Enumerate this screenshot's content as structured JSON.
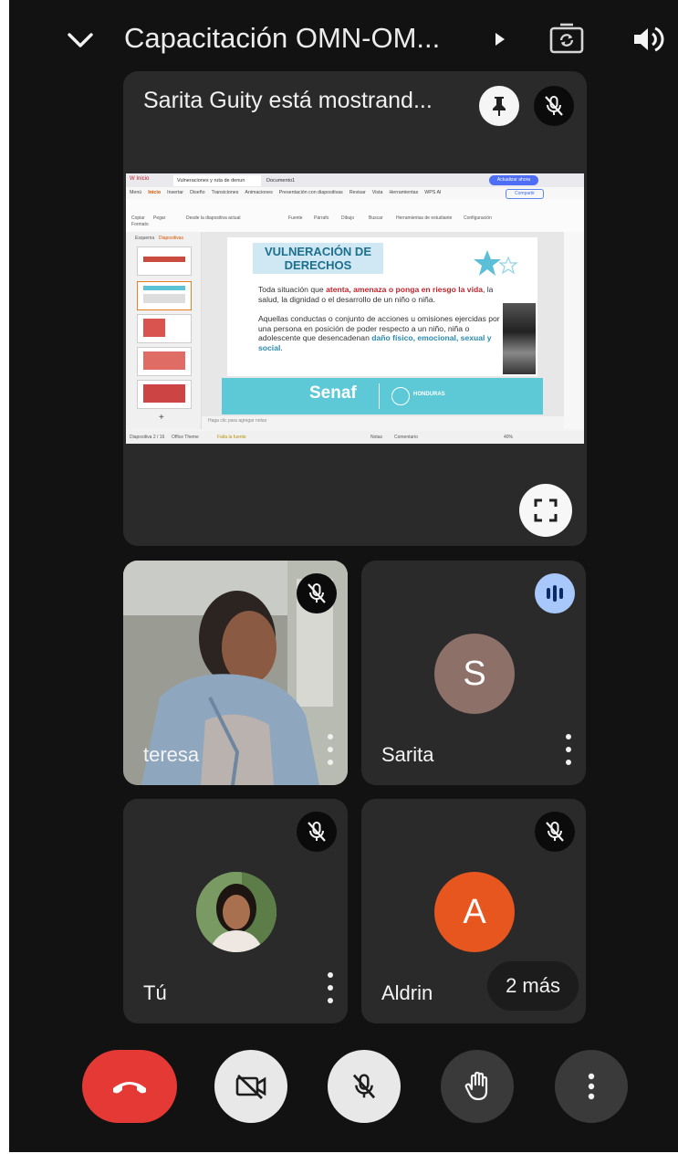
{
  "topbar": {
    "title": "Capacitación OMN-OM...",
    "icons": [
      "chevron-down-icon",
      "play-arrow-icon",
      "switch-camera-icon",
      "speaker-icon"
    ]
  },
  "presentation": {
    "presenter_label": "Sarita Guity está mostrand...",
    "icons": [
      "pin-icon",
      "mic-off-icon",
      "fullscreen-icon"
    ],
    "shared_screen": {
      "tabs": [
        "Vulneraciones y ruta de denun",
        "Documento1"
      ],
      "update_button": "Actualizar ahora",
      "menu": [
        "Menú",
        "Inicio",
        "Insertar",
        "Diseño",
        "Transiciones",
        "Animaciones",
        "Presentación con diapositivas",
        "Revisar",
        "Vista",
        "Herramientas",
        "WPS AI"
      ],
      "share_button": "Compartir",
      "ribbon": [
        "Copiar",
        "Formato",
        "Pegar",
        "Desde la diapositiva actual",
        "Fuente",
        "Párrafo",
        "Dibujo",
        "Buscar",
        "Herramientas de estudiante",
        "Configuración"
      ],
      "panel_tabs": [
        "Esquema",
        "Diapositivas"
      ],
      "slide": {
        "title_line1": "VULNERACIÓN DE",
        "title_line2": "DERECHOS",
        "p1_a": "Toda situación que ",
        "p1_red1": "atenta, amenaza o ponga en riesgo la vida",
        "p1_b": ", la salud, la dignidad o el desarrollo de un niño o niña.",
        "p2_a": "Aquellas conductas o conjunto de acciones u omisiones ejercidas por una persona en posición de poder respecto a un niño, niña o adolescente que desencadenan ",
        "p2_blue": "daño físico, emocional, sexual y social",
        "p2_b": ".",
        "logo_text": "Senaf",
        "country_text": "HONDURAS"
      },
      "notes_placeholder": "Haga clic para agregar notas",
      "status": {
        "slide_count": "Diapositiva 2 / 16",
        "theme": "Office Theme",
        "font_warning": "Falta la fuente",
        "notes": "Notas",
        "comments": "Comentario",
        "zoom": "40%"
      }
    }
  },
  "participants": [
    {
      "name": "teresa",
      "status_icon": "mic-off-icon",
      "kind": "video"
    },
    {
      "name": "Sarita",
      "status_icon": "speaking-icon",
      "initial": "S",
      "avatar_color": "#8d7068",
      "kind": "letter"
    },
    {
      "name": "Tú",
      "status_icon": "mic-off-icon",
      "kind": "photo"
    },
    {
      "name": "Aldrin",
      "status_icon": "mic-off-icon",
      "initial": "A",
      "avatar_color": "#e8561f",
      "kind": "letter",
      "more_label": "2 más"
    }
  ],
  "controls": [
    {
      "name": "end-call-button",
      "icon": "hang-up-icon",
      "color": "#e53935"
    },
    {
      "name": "camera-toggle-button",
      "icon": "camera-off-icon",
      "color": "#e8e8e8"
    },
    {
      "name": "mic-toggle-button",
      "icon": "mic-off-icon",
      "color": "#e8e8e8"
    },
    {
      "name": "raise-hand-button",
      "icon": "hand-icon",
      "color": "#3a3a3a"
    },
    {
      "name": "more-options-button",
      "icon": "more-vert-icon",
      "color": "#3a3a3a"
    }
  ]
}
